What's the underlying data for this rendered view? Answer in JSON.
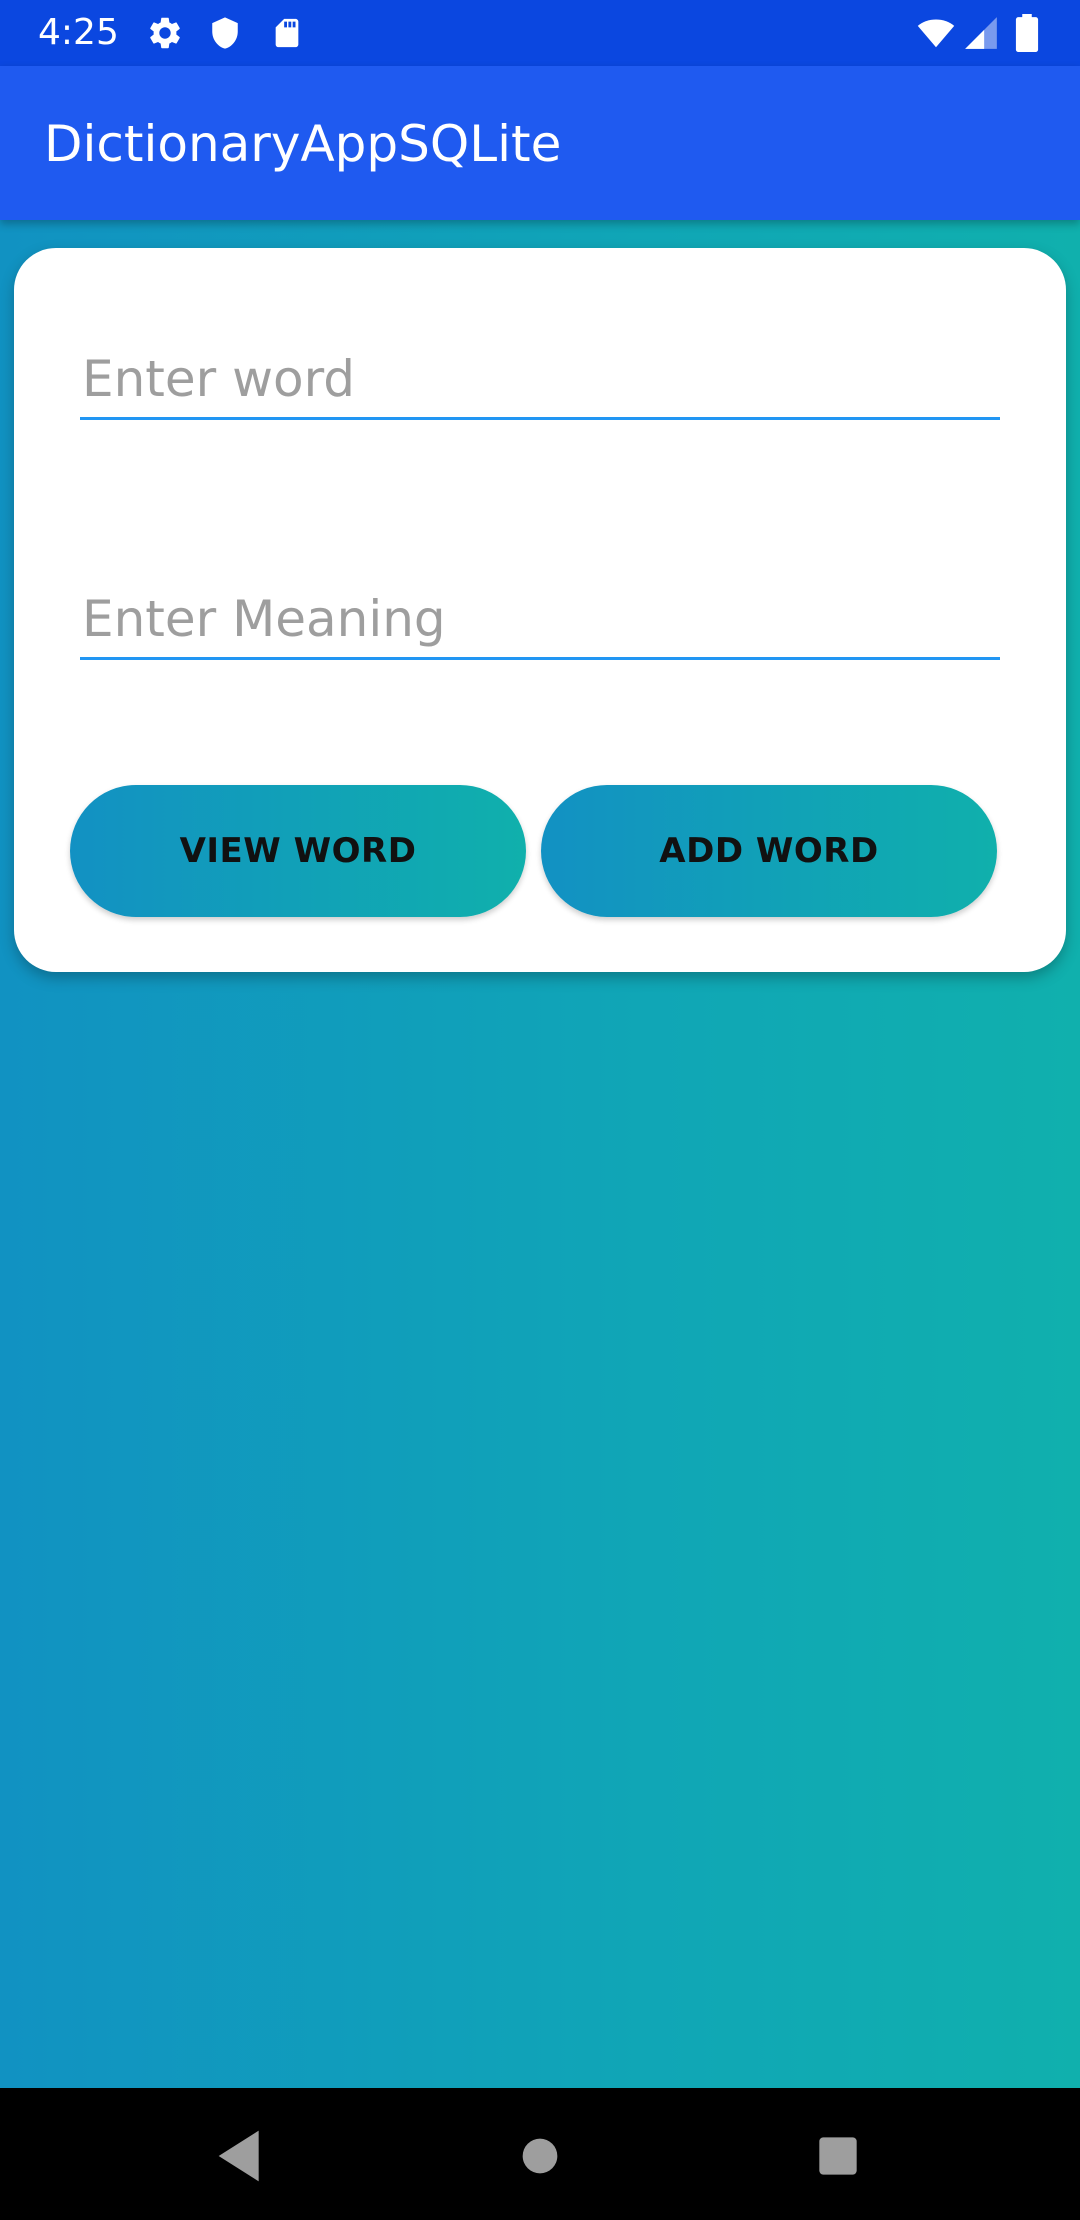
{
  "status_bar": {
    "time": "4:25",
    "icons": [
      "gear-icon",
      "shield-icon",
      "sd-card-icon",
      "wifi-icon",
      "cellular-signal-icon",
      "battery-icon"
    ]
  },
  "app_bar": {
    "title": "DictionaryAppSQLite"
  },
  "form": {
    "word_field": {
      "value": "",
      "placeholder": "Enter word"
    },
    "meaning_field": {
      "value": "",
      "placeholder": "Enter Meaning"
    },
    "view_word_label": "VIEW WORD",
    "add_word_label": "ADD WORD"
  },
  "nav_bar": {
    "icons": [
      "back-icon",
      "home-icon",
      "recents-icon"
    ]
  },
  "colors": {
    "status_bar": "#0b47e0",
    "app_bar": "#1f5af0",
    "gradient_start": "#1192c2",
    "gradient_end": "#10b0ad",
    "field_underline": "#2196f3"
  }
}
